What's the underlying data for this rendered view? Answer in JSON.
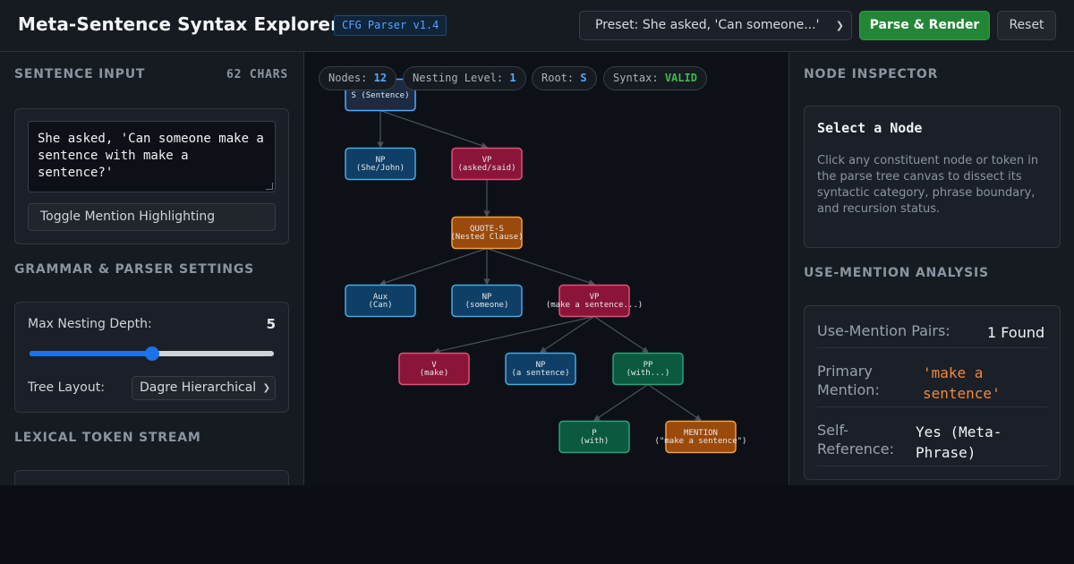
{
  "header": {
    "title": "Meta-Sentence Syntax Explorer",
    "version": "CFG Parser v1.4",
    "preset": "Preset: She asked, 'Can someone...'",
    "parse_button": "Parse & Render",
    "reset_button": "Reset"
  },
  "left": {
    "input_title": "SENTENCE INPUT",
    "char_count": "62 CHARS",
    "sentence": "She asked, 'Can someone make a sentence with make a sentence?'",
    "toggle_label": "Toggle Mention Highlighting",
    "settings_title": "GRAMMAR & PARSER SETTINGS",
    "depth_label": "Max Nesting Depth:",
    "depth_value": "5",
    "depth_min": 1,
    "depth_max": 9,
    "layout_label": "Tree Layout:",
    "layout_value": "Dagre Hierarchical",
    "token_title": "LEXICAL TOKEN STREAM"
  },
  "stats": {
    "nodes_label": "Nodes:",
    "nodes": "12",
    "nesting_label": "Nesting Level:",
    "nesting": "1",
    "root_label": "Root:",
    "root": "S",
    "syntax_label": "Syntax:",
    "syntax": "VALID"
  },
  "tree": {
    "colors": {
      "root": {
        "fill": "#1c2b42",
        "stroke": "#58a6ff"
      },
      "np": {
        "fill": "#0f3f66",
        "stroke": "#4aa8e0"
      },
      "vp": {
        "fill": "#8a1538",
        "stroke": "#e0507a"
      },
      "quote": {
        "fill": "#9a4a0b",
        "stroke": "#f0a040"
      },
      "pp": {
        "fill": "#0b5a40",
        "stroke": "#2ea078"
      }
    },
    "nodes": [
      {
        "id": "S",
        "kind": "root",
        "line1": "S (Sentence)",
        "line2": ""
      },
      {
        "id": "NP1",
        "kind": "np",
        "line1": "NP",
        "line2": "(She/John)"
      },
      {
        "id": "VP1",
        "kind": "vp",
        "line1": "VP",
        "line2": "(asked/said)"
      },
      {
        "id": "QS",
        "kind": "quote",
        "line1": "QUOTE-S",
        "line2": "(Nested Clause)"
      },
      {
        "id": "AUX",
        "kind": "np",
        "line1": "Aux",
        "line2": "(Can)"
      },
      {
        "id": "NP2",
        "kind": "np",
        "line1": "NP",
        "line2": "(someone)"
      },
      {
        "id": "VP2",
        "kind": "vp",
        "line1": "VP",
        "line2": "(make a sentence...)"
      },
      {
        "id": "V",
        "kind": "vp",
        "line1": "V",
        "line2": "(make)"
      },
      {
        "id": "NP3",
        "kind": "np",
        "line1": "NP",
        "line2": "(a sentence)"
      },
      {
        "id": "PP",
        "kind": "pp",
        "line1": "PP",
        "line2": "(with...)"
      },
      {
        "id": "P",
        "kind": "pp",
        "line1": "P",
        "line2": "(with)"
      },
      {
        "id": "MEN",
        "kind": "quote",
        "line1": "MENTION",
        "line2": "(\"make a sentence\")"
      }
    ],
    "edges": [
      [
        "S",
        "NP1"
      ],
      [
        "S",
        "VP1"
      ],
      [
        "VP1",
        "QS"
      ],
      [
        "QS",
        "AUX"
      ],
      [
        "QS",
        "NP2"
      ],
      [
        "QS",
        "VP2"
      ],
      [
        "VP2",
        "V"
      ],
      [
        "VP2",
        "NP3"
      ],
      [
        "VP2",
        "PP"
      ],
      [
        "PP",
        "P"
      ],
      [
        "PP",
        "MEN"
      ]
    ]
  },
  "right": {
    "inspector_title": "NODE INSPECTOR",
    "select_title": "Select a Node",
    "select_desc": "Click any constituent node or token in the parse tree canvas to dissect its syntactic category, phrase boundary, and recursion status.",
    "analysis_title": "USE-MENTION ANALYSIS",
    "pairs_label": "Use-Mention Pairs:",
    "pairs_value": "1 Found",
    "primary_label": "Primary Mention:",
    "primary_value": "'make a sentence'",
    "self_label": "Self-Reference:",
    "self_value": "Yes (Meta-Phrase)"
  }
}
